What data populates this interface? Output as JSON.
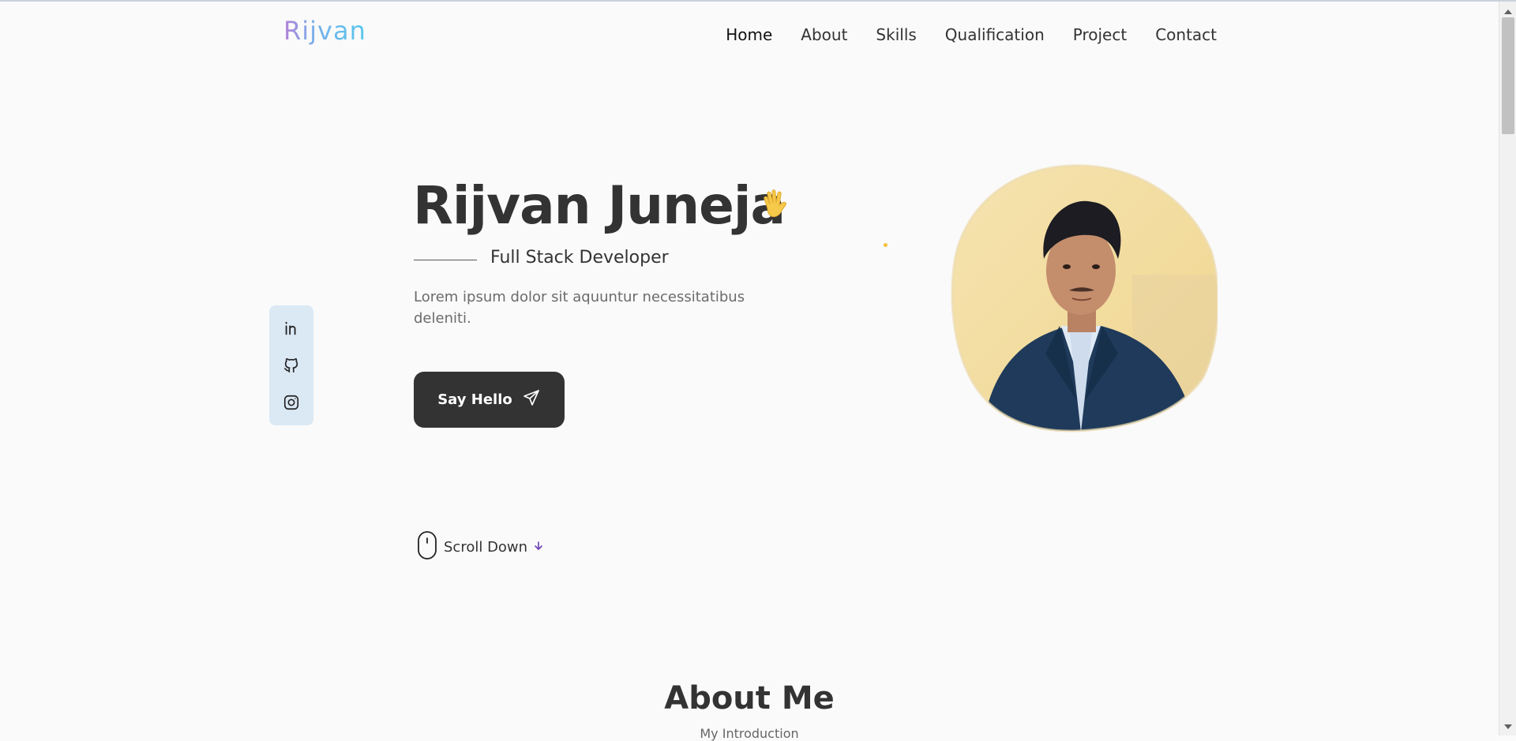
{
  "header": {
    "logo": "Rijvan",
    "nav": [
      {
        "label": "Home"
      },
      {
        "label": "About"
      },
      {
        "label": "Skills"
      },
      {
        "label": "Qualification"
      },
      {
        "label": "Project"
      },
      {
        "label": "Contact"
      }
    ]
  },
  "social": [
    "linkedin-icon",
    "github-icon",
    "instagram-icon"
  ],
  "hero": {
    "name": "Rijvan Juneja",
    "subtitle": "Full Stack Developer",
    "description": "Lorem ipsum dolor sit aquuntur necessitatibus deleniti.",
    "cta_label": "Say Hello",
    "scroll_label": "Scroll Down"
  },
  "about": {
    "title": "About Me",
    "subtitle": "My Introduction"
  },
  "colors": {
    "dark": "#333333",
    "social_bg": "#dbe9f5",
    "accent_yellow": "#f2c23a"
  }
}
